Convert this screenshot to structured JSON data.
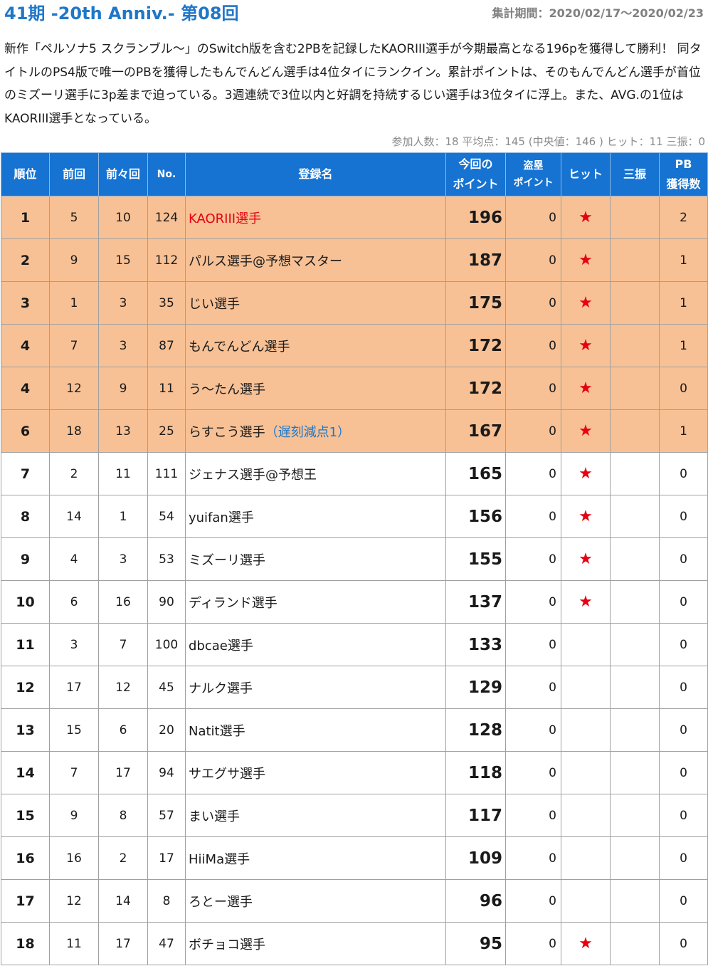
{
  "header": {
    "title": "41期 -20th Anniv.- 第08回",
    "period": "集計期間：2020/02/17～2020/02/23"
  },
  "description": "新作「ペルソナ5 スクランブル～」のSwitch版を含む2PBを記録したKAORIII選手が今期最高となる196pを獲得して勝利！ 同タイトルのPS4版で唯一のPBを獲得したもんでんどん選手は4位タイにランクイン。累計ポイントは、そのもんでんどん選手が首位のミズーリ選手に3p差まで迫っている。3週連続で3位以内と好調を持続するじい選手は3位タイに浮上。また、AVG.の1位はKAORIII選手となっている。",
  "stats": "参加人数：18 平均点：145 (中央値：146 ) ヒット：11 三振：0",
  "table": {
    "headers": {
      "rank": "順位",
      "prev": "前回",
      "prev2": "前々回",
      "no": "No.",
      "name": "登録名",
      "points_line1": "今回の",
      "points_line2": "ポイント",
      "steal_line1": "盗塁",
      "steal_line2": "ポイント",
      "hit": "ヒット",
      "strikeout": "三振",
      "pb_line1": "PB",
      "pb_line2": "獲得数"
    },
    "hit_mark": "★",
    "rows": [
      {
        "rank": "1",
        "prev": "5",
        "prev2": "10",
        "no": "124",
        "name": "KAORIII選手",
        "note": "",
        "points": "196",
        "steal": "0",
        "hit": true,
        "strikeout": "",
        "pb": "2",
        "highlight": true,
        "name_red": true
      },
      {
        "rank": "2",
        "prev": "9",
        "prev2": "15",
        "no": "112",
        "name": "パルス選手@予想マスター",
        "note": "",
        "points": "187",
        "steal": "0",
        "hit": true,
        "strikeout": "",
        "pb": "1",
        "highlight": true,
        "name_red": false
      },
      {
        "rank": "3",
        "prev": "1",
        "prev2": "3",
        "no": "35",
        "name": "じい選手",
        "note": "",
        "points": "175",
        "steal": "0",
        "hit": true,
        "strikeout": "",
        "pb": "1",
        "highlight": true,
        "name_red": false
      },
      {
        "rank": "4",
        "prev": "7",
        "prev2": "3",
        "no": "87",
        "name": "もんでんどん選手",
        "note": "",
        "points": "172",
        "steal": "0",
        "hit": true,
        "strikeout": "",
        "pb": "1",
        "highlight": true,
        "name_red": false
      },
      {
        "rank": "4",
        "prev": "12",
        "prev2": "9",
        "no": "11",
        "name": "う～たん選手",
        "note": "",
        "points": "172",
        "steal": "0",
        "hit": true,
        "strikeout": "",
        "pb": "0",
        "highlight": true,
        "name_red": false
      },
      {
        "rank": "6",
        "prev": "18",
        "prev2": "13",
        "no": "25",
        "name": "らすこう選手",
        "note": "（遅刻減点1）",
        "points": "167",
        "steal": "0",
        "hit": true,
        "strikeout": "",
        "pb": "1",
        "highlight": true,
        "name_red": false
      },
      {
        "rank": "7",
        "prev": "2",
        "prev2": "11",
        "no": "111",
        "name": "ジェナス選手@予想王",
        "note": "",
        "points": "165",
        "steal": "0",
        "hit": true,
        "strikeout": "",
        "pb": "0",
        "highlight": false,
        "name_red": false
      },
      {
        "rank": "8",
        "prev": "14",
        "prev2": "1",
        "no": "54",
        "name": "yuifan選手",
        "note": "",
        "points": "156",
        "steal": "0",
        "hit": true,
        "strikeout": "",
        "pb": "0",
        "highlight": false,
        "name_red": false
      },
      {
        "rank": "9",
        "prev": "4",
        "prev2": "3",
        "no": "53",
        "name": "ミズーリ選手",
        "note": "",
        "points": "155",
        "steal": "0",
        "hit": true,
        "strikeout": "",
        "pb": "0",
        "highlight": false,
        "name_red": false
      },
      {
        "rank": "10",
        "prev": "6",
        "prev2": "16",
        "no": "90",
        "name": "ディランド選手",
        "note": "",
        "points": "137",
        "steal": "0",
        "hit": true,
        "strikeout": "",
        "pb": "0",
        "highlight": false,
        "name_red": false
      },
      {
        "rank": "11",
        "prev": "3",
        "prev2": "7",
        "no": "100",
        "name": "dbcae選手",
        "note": "",
        "points": "133",
        "steal": "0",
        "hit": false,
        "strikeout": "",
        "pb": "0",
        "highlight": false,
        "name_red": false
      },
      {
        "rank": "12",
        "prev": "17",
        "prev2": "12",
        "no": "45",
        "name": "ナルク選手",
        "note": "",
        "points": "129",
        "steal": "0",
        "hit": false,
        "strikeout": "",
        "pb": "0",
        "highlight": false,
        "name_red": false
      },
      {
        "rank": "13",
        "prev": "15",
        "prev2": "6",
        "no": "20",
        "name": "Natit選手",
        "note": "",
        "points": "128",
        "steal": "0",
        "hit": false,
        "strikeout": "",
        "pb": "0",
        "highlight": false,
        "name_red": false
      },
      {
        "rank": "14",
        "prev": "7",
        "prev2": "17",
        "no": "94",
        "name": "サエグサ選手",
        "note": "",
        "points": "118",
        "steal": "0",
        "hit": false,
        "strikeout": "",
        "pb": "0",
        "highlight": false,
        "name_red": false
      },
      {
        "rank": "15",
        "prev": "9",
        "prev2": "8",
        "no": "57",
        "name": "まい選手",
        "note": "",
        "points": "117",
        "steal": "0",
        "hit": false,
        "strikeout": "",
        "pb": "0",
        "highlight": false,
        "name_red": false
      },
      {
        "rank": "16",
        "prev": "16",
        "prev2": "2",
        "no": "17",
        "name": "HiiMa選手",
        "note": "",
        "points": "109",
        "steal": "0",
        "hit": false,
        "strikeout": "",
        "pb": "0",
        "highlight": false,
        "name_red": false
      },
      {
        "rank": "17",
        "prev": "12",
        "prev2": "14",
        "no": "8",
        "name": "ろとー選手",
        "note": "",
        "points": "96",
        "steal": "0",
        "hit": false,
        "strikeout": "",
        "pb": "0",
        "highlight": false,
        "name_red": false
      },
      {
        "rank": "18",
        "prev": "11",
        "prev2": "17",
        "no": "47",
        "name": "ボチョコ選手",
        "note": "",
        "points": "95",
        "steal": "0",
        "hit": true,
        "strikeout": "",
        "pb": "0",
        "highlight": false,
        "name_red": false
      }
    ]
  },
  "colors": {
    "title": "#1f77c8",
    "header_bg": "#1673d1",
    "highlight_row": "#f7c195",
    "hit_star": "#e60012",
    "note_text": "#1f77c8"
  }
}
